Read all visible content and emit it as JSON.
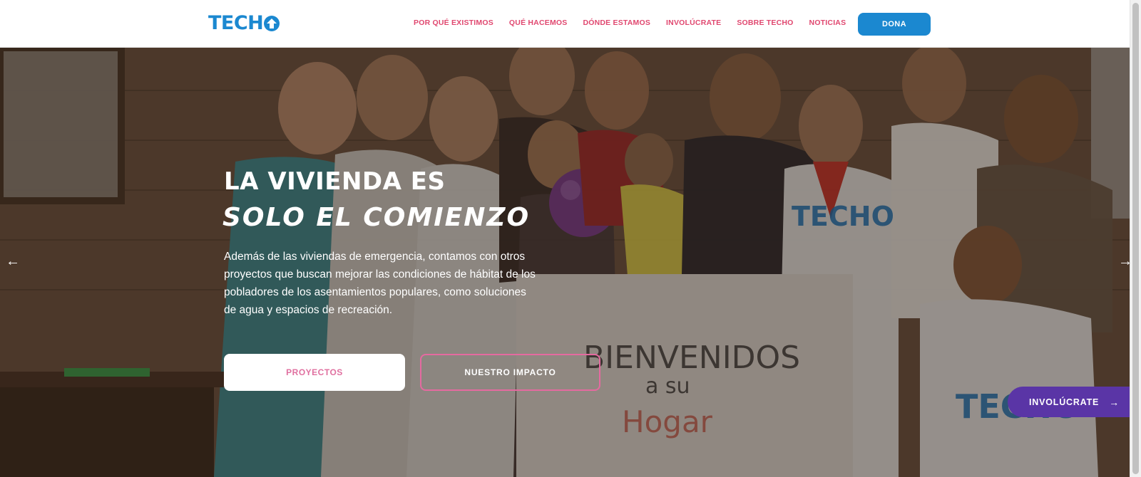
{
  "header": {
    "logo_text": "TECH",
    "nav": [
      {
        "label": "POR QUÉ EXISTIMOS"
      },
      {
        "label": "QUÉ HACEMOS"
      },
      {
        "label": "DÓNDE ESTAMOS"
      },
      {
        "label": "INVOLÚCRATE"
      },
      {
        "label": "SOBRE TECHO"
      },
      {
        "label": "NOTICIAS"
      }
    ],
    "donate_label": "DONA"
  },
  "hero": {
    "title_line1": "LA VIVIENDA ES",
    "title_line2": "SOLO EL COMIENZO",
    "description": "Además de las viviendas de emergencia, contamos con otros proyectos que buscan mejorar las condiciones de hábitat de los pobladores de los asentamientos populares, como soluciones de agua y espacios de recreación.",
    "button_primary": "PROYECTOS",
    "button_secondary": "NUESTRO IMPACTO",
    "arrow_prev": "←",
    "arrow_next": "→",
    "sign_text": [
      "BIENVENIDOS",
      "a su",
      "Hogar"
    ],
    "shirt_text": "TECHO"
  },
  "floating_cta": {
    "label": "INVOLÚCRATE",
    "arrow": "→"
  },
  "colors": {
    "brand_blue": "#1b88d0",
    "nav_pink": "#e0476f",
    "cta_purple": "#5a35a6",
    "outline_pink": "#e56aa0"
  }
}
